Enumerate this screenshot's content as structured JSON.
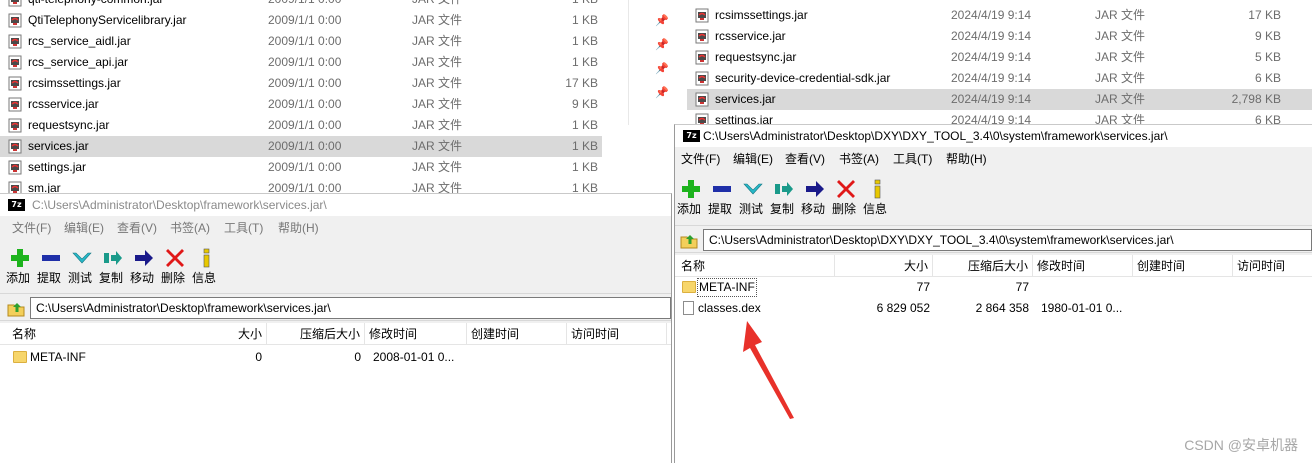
{
  "left_explorer": {
    "files": [
      {
        "name": "qti-telephony-common.jar",
        "date": "2009/1/1 0:00",
        "type": "JAR 文件",
        "size": "1 KB",
        "selected": false
      },
      {
        "name": "QtiTelephonyServicelibrary.jar",
        "date": "2009/1/1 0:00",
        "type": "JAR 文件",
        "size": "1 KB",
        "selected": false
      },
      {
        "name": "rcs_service_aidl.jar",
        "date": "2009/1/1 0:00",
        "type": "JAR 文件",
        "size": "1 KB",
        "selected": false
      },
      {
        "name": "rcs_service_api.jar",
        "date": "2009/1/1 0:00",
        "type": "JAR 文件",
        "size": "1 KB",
        "selected": false
      },
      {
        "name": "rcsimssettings.jar",
        "date": "2009/1/1 0:00",
        "type": "JAR 文件",
        "size": "17 KB",
        "selected": false
      },
      {
        "name": "rcsservice.jar",
        "date": "2009/1/1 0:00",
        "type": "JAR 文件",
        "size": "9 KB",
        "selected": false
      },
      {
        "name": "requestsync.jar",
        "date": "2009/1/1 0:00",
        "type": "JAR 文件",
        "size": "1 KB",
        "selected": false
      },
      {
        "name": "services.jar",
        "date": "2009/1/1 0:00",
        "type": "JAR 文件",
        "size": "1 KB",
        "selected": true
      },
      {
        "name": "settings.jar",
        "date": "2009/1/1 0:00",
        "type": "JAR 文件",
        "size": "1 KB",
        "selected": false
      },
      {
        "name": "sm.jar",
        "date": "2009/1/1 0:00",
        "type": "JAR 文件",
        "size": "1 KB",
        "selected": false
      }
    ]
  },
  "right_explorer": {
    "files": [
      {
        "name": "rcsimssettings.jar",
        "date": "2024/4/19 9:14",
        "type": "JAR 文件",
        "size": "17 KB",
        "selected": false
      },
      {
        "name": "rcsservice.jar",
        "date": "2024/4/19 9:14",
        "type": "JAR 文件",
        "size": "9 KB",
        "selected": false
      },
      {
        "name": "requestsync.jar",
        "date": "2024/4/19 9:14",
        "type": "JAR 文件",
        "size": "5 KB",
        "selected": false
      },
      {
        "name": "security-device-credential-sdk.jar",
        "date": "2024/4/19 9:14",
        "type": "JAR 文件",
        "size": "6 KB",
        "selected": false
      },
      {
        "name": "services.jar",
        "date": "2024/4/19 9:14",
        "type": "JAR 文件",
        "size": "2,798 KB",
        "selected": true
      },
      {
        "name": "settings.jar",
        "date": "2024/4/19 9:14",
        "type": "JAR 文件",
        "size": "6 KB",
        "selected": false
      }
    ]
  },
  "sevenzip_left": {
    "title": "C:\\Users\\Administrator\\Desktop\\framework\\services.jar\\",
    "menu": [
      "文件(F)",
      "编辑(E)",
      "查看(V)",
      "书签(A)",
      "工具(T)",
      "帮助(H)"
    ],
    "toolbar": [
      "添加",
      "提取",
      "测试",
      "复制",
      "移动",
      "删除",
      "信息"
    ],
    "address": "C:\\Users\\Administrator\\Desktop\\framework\\services.jar\\",
    "columns": [
      "名称",
      "大小",
      "压缩后大小",
      "修改时间",
      "创建时间",
      "访问时间"
    ],
    "rows": [
      {
        "name": "META-INF",
        "kind": "folder",
        "size": "0",
        "packed": "0",
        "modified": "2008-01-01 0..."
      }
    ]
  },
  "sevenzip_right": {
    "title": "C:\\Users\\Administrator\\Desktop\\DXY\\DXY_TOOL_3.4\\0\\system\\framework\\services.jar\\",
    "menu": [
      "文件(F)",
      "编辑(E)",
      "查看(V)",
      "书签(A)",
      "工具(T)",
      "帮助(H)"
    ],
    "toolbar": [
      "添加",
      "提取",
      "测试",
      "复制",
      "移动",
      "删除",
      "信息"
    ],
    "address": "C:\\Users\\Administrator\\Desktop\\DXY\\DXY_TOOL_3.4\\0\\system\\framework\\services.jar\\",
    "columns": [
      "名称",
      "大小",
      "压缩后大小",
      "修改时间",
      "创建时间",
      "访问时间"
    ],
    "rows": [
      {
        "name": "META-INF",
        "kind": "folder",
        "size": "77",
        "packed": "77",
        "modified": ""
      },
      {
        "name": "classes.dex",
        "kind": "file",
        "size": "6 829 052",
        "packed": "2 864 358",
        "modified": "1980-01-01 0..."
      }
    ]
  },
  "watermark": "CSDN @安卓机器",
  "colors": {
    "selected_row": "#d9d9d9",
    "add_icon": "#1db31d",
    "extract_icon": "#1f2fa8",
    "test_icon": "#28b8c8",
    "copy_icon": "#1a9a8a",
    "move_icon": "#1a1a8a",
    "delete_icon": "#e01818",
    "info_icon": "#e8c800",
    "arrow": "#e8312a"
  }
}
